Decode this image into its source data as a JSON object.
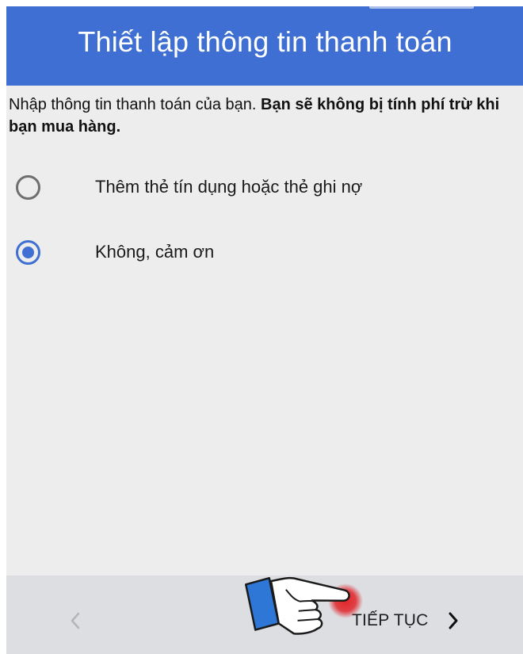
{
  "header": {
    "title": "Thiết lập thông tin thanh toán"
  },
  "intro": {
    "text": "Nhập thông tin thanh toán của bạn. ",
    "bold_text": "Bạn sẽ không bị tính phí trừ khi bạn mua hàng."
  },
  "options": [
    {
      "label": "Thêm thẻ tín dụng hoặc thẻ ghi nợ",
      "selected": false
    },
    {
      "label": "Không, cảm ơn",
      "selected": true
    }
  ],
  "footer": {
    "back_icon": "chevron-left-icon",
    "next_label": "TIẾP TỤC",
    "next_icon": "chevron-right-icon"
  },
  "colors": {
    "accent": "#3f6fd2",
    "background": "#ededed",
    "footer": "#dcdee2",
    "pointer_highlight": "#e0262a"
  }
}
